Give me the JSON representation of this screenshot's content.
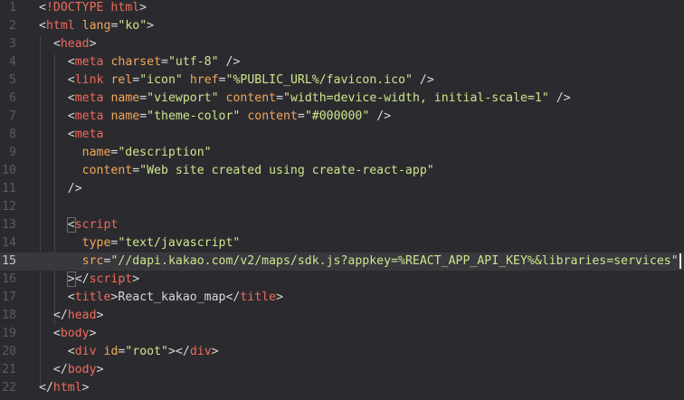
{
  "editor": {
    "language": "html",
    "current_line": 15,
    "colors": {
      "background": "#2b2b2f",
      "current_line_bg": "#38383d",
      "tag": "#ee6a5c",
      "attribute": "#f2a65a",
      "string": "#cde58d",
      "text": "#d8d8d8",
      "line_number": "#5a5a60"
    },
    "lines": [
      {
        "num": "1",
        "tokens": [
          [
            "p",
            "<"
          ],
          [
            "d",
            "!DOCTYPE html"
          ],
          [
            "p",
            ">"
          ]
        ]
      },
      {
        "num": "2",
        "tokens": [
          [
            "p",
            "<"
          ],
          [
            "t",
            "html"
          ],
          [
            "w",
            " "
          ],
          [
            "a",
            "lang"
          ],
          [
            "p",
            "="
          ],
          [
            "s",
            "\"ko\""
          ],
          [
            "p",
            ">"
          ]
        ]
      },
      {
        "num": "3",
        "tokens": [
          [
            "w",
            "  "
          ],
          [
            "p",
            "<"
          ],
          [
            "t",
            "head"
          ],
          [
            "p",
            ">"
          ]
        ]
      },
      {
        "num": "4",
        "tokens": [
          [
            "w",
            "    "
          ],
          [
            "p",
            "<"
          ],
          [
            "t",
            "meta"
          ],
          [
            "w",
            " "
          ],
          [
            "a",
            "charset"
          ],
          [
            "p",
            "="
          ],
          [
            "s",
            "\"utf-8\""
          ],
          [
            "w",
            " "
          ],
          [
            "p",
            "/>"
          ]
        ]
      },
      {
        "num": "5",
        "tokens": [
          [
            "w",
            "    "
          ],
          [
            "p",
            "<"
          ],
          [
            "t",
            "link"
          ],
          [
            "w",
            " "
          ],
          [
            "a",
            "rel"
          ],
          [
            "p",
            "="
          ],
          [
            "s",
            "\"icon\""
          ],
          [
            "w",
            " "
          ],
          [
            "a",
            "href"
          ],
          [
            "p",
            "="
          ],
          [
            "s",
            "\"%PUBLIC_URL%/favicon.ico\""
          ],
          [
            "w",
            " "
          ],
          [
            "p",
            "/>"
          ]
        ]
      },
      {
        "num": "6",
        "tokens": [
          [
            "w",
            "    "
          ],
          [
            "p",
            "<"
          ],
          [
            "t",
            "meta"
          ],
          [
            "w",
            " "
          ],
          [
            "a",
            "name"
          ],
          [
            "p",
            "="
          ],
          [
            "s",
            "\"viewport\""
          ],
          [
            "w",
            " "
          ],
          [
            "a",
            "content"
          ],
          [
            "p",
            "="
          ],
          [
            "s",
            "\"width=device-width, initial-scale=1\""
          ],
          [
            "w",
            " "
          ],
          [
            "p",
            "/>"
          ]
        ]
      },
      {
        "num": "7",
        "tokens": [
          [
            "w",
            "    "
          ],
          [
            "p",
            "<"
          ],
          [
            "t",
            "meta"
          ],
          [
            "w",
            " "
          ],
          [
            "a",
            "name"
          ],
          [
            "p",
            "="
          ],
          [
            "s",
            "\"theme-color\""
          ],
          [
            "w",
            " "
          ],
          [
            "a",
            "content"
          ],
          [
            "p",
            "="
          ],
          [
            "s",
            "\"#000000\""
          ],
          [
            "w",
            " "
          ],
          [
            "p",
            "/>"
          ]
        ]
      },
      {
        "num": "8",
        "tokens": [
          [
            "w",
            "    "
          ],
          [
            "p",
            "<"
          ],
          [
            "t",
            "meta"
          ]
        ]
      },
      {
        "num": "9",
        "tokens": [
          [
            "w",
            "      "
          ],
          [
            "a",
            "name"
          ],
          [
            "p",
            "="
          ],
          [
            "s",
            "\"description\""
          ]
        ]
      },
      {
        "num": "10",
        "tokens": [
          [
            "w",
            "      "
          ],
          [
            "a",
            "content"
          ],
          [
            "p",
            "="
          ],
          [
            "s",
            "\"Web site created using create-react-app\""
          ]
        ]
      },
      {
        "num": "11",
        "tokens": [
          [
            "w",
            "    "
          ],
          [
            "p",
            "/>"
          ]
        ]
      },
      {
        "num": "12",
        "tokens": []
      },
      {
        "num": "13",
        "tokens": [
          [
            "w",
            "    "
          ],
          [
            "b",
            "<"
          ],
          [
            "t",
            "script"
          ]
        ]
      },
      {
        "num": "14",
        "tokens": [
          [
            "w",
            "      "
          ],
          [
            "a",
            "type"
          ],
          [
            "p",
            "="
          ],
          [
            "s",
            "\"text/javascript\""
          ]
        ]
      },
      {
        "num": "15",
        "tokens": [
          [
            "w",
            "      "
          ],
          [
            "a",
            "src"
          ],
          [
            "p",
            "="
          ],
          [
            "s",
            "\"//dapi.kakao.com/v2/maps/sdk.js?appkey=%REACT_APP_API_KEY%&libraries=services\""
          ],
          [
            "c",
            ""
          ]
        ]
      },
      {
        "num": "16",
        "tokens": [
          [
            "w",
            "    "
          ],
          [
            "b",
            ">"
          ],
          [
            "p",
            "</"
          ],
          [
            "t",
            "script"
          ],
          [
            "p",
            ">"
          ]
        ]
      },
      {
        "num": "17",
        "tokens": [
          [
            "w",
            "    "
          ],
          [
            "p",
            "<"
          ],
          [
            "t",
            "title"
          ],
          [
            "p",
            ">"
          ],
          [
            "x",
            "React_kakao_map"
          ],
          [
            "p",
            "</"
          ],
          [
            "t",
            "title"
          ],
          [
            "p",
            ">"
          ]
        ]
      },
      {
        "num": "18",
        "tokens": [
          [
            "w",
            "  "
          ],
          [
            "p",
            "</"
          ],
          [
            "t",
            "head"
          ],
          [
            "p",
            ">"
          ]
        ]
      },
      {
        "num": "19",
        "tokens": [
          [
            "w",
            "  "
          ],
          [
            "p",
            "<"
          ],
          [
            "t",
            "body"
          ],
          [
            "p",
            ">"
          ]
        ]
      },
      {
        "num": "20",
        "tokens": [
          [
            "w",
            "    "
          ],
          [
            "p",
            "<"
          ],
          [
            "t",
            "div"
          ],
          [
            "w",
            " "
          ],
          [
            "a",
            "id"
          ],
          [
            "p",
            "="
          ],
          [
            "s",
            "\"root\""
          ],
          [
            "p",
            "></"
          ],
          [
            "t",
            "div"
          ],
          [
            "p",
            ">"
          ]
        ]
      },
      {
        "num": "21",
        "tokens": [
          [
            "w",
            "  "
          ],
          [
            "p",
            "</"
          ],
          [
            "t",
            "body"
          ],
          [
            "p",
            ">"
          ]
        ]
      },
      {
        "num": "22",
        "tokens": [
          [
            "p",
            "</"
          ],
          [
            "t",
            "html"
          ],
          [
            "p",
            ">"
          ]
        ]
      }
    ]
  }
}
